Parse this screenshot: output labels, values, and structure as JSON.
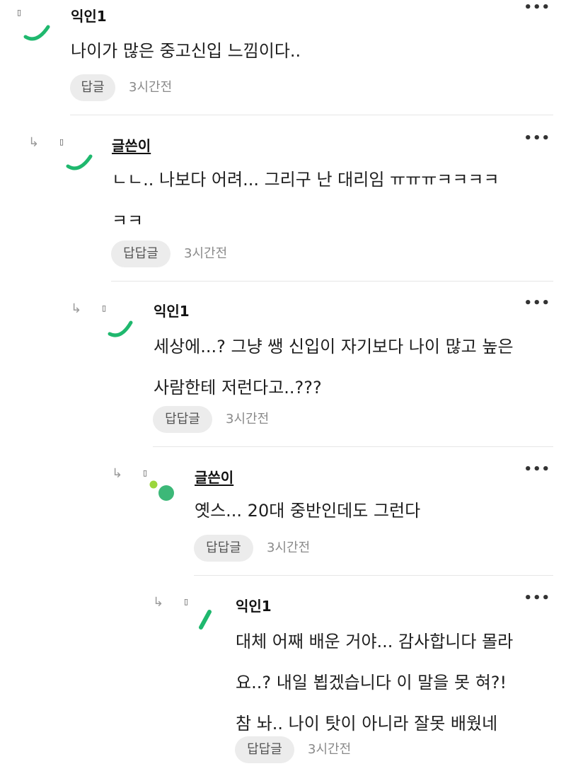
{
  "comments": [
    {
      "author": "익인1",
      "lines": [
        "나이가 많은 중고신입 느낌이다.."
      ],
      "reply_label": "답글",
      "time": "3시간전",
      "more": "•••"
    },
    {
      "author": "글쓴이",
      "lines": [
        "ㄴㄴ.. 나보다 어려... 그리구 난 대리임 ㅠㅠㅠㅋㅋㅋㅋ",
        "ㅋㅋ"
      ],
      "reply_label": "답답글",
      "time": "3시간전",
      "more": "•••"
    },
    {
      "author": "익인1",
      "lines": [
        "세상에...? 그냥 쌩 신입이 자기보다 나이 많고 높은",
        "사람한테 저런다고..???"
      ],
      "reply_label": "답답글",
      "time": "3시간전",
      "more": "•••"
    },
    {
      "author": "글쓴이",
      "lines": [
        "옛스... 20대 중반인데도 그런다"
      ],
      "reply_label": "답답글",
      "time": "3시간전",
      "more": "•••"
    },
    {
      "author": "익인1",
      "lines": [
        "대체 어째 배운 거야... 감사합니다 몰라",
        "요..? 내일 뵙겠습니다 이 말을 못 혀?!",
        "참 놔.. 나이 탓이 아니라 잘못 배웠네"
      ],
      "reply_label": "답답글",
      "time": "3시간전",
      "more": "•••"
    }
  ],
  "reply_arrow_glyph": "↳",
  "badge_glyph": "▯",
  "colors": {
    "avatar_green": "#1fb86e",
    "avatar_light": "#9bd63c",
    "avatar_dot": "#3cb878"
  }
}
